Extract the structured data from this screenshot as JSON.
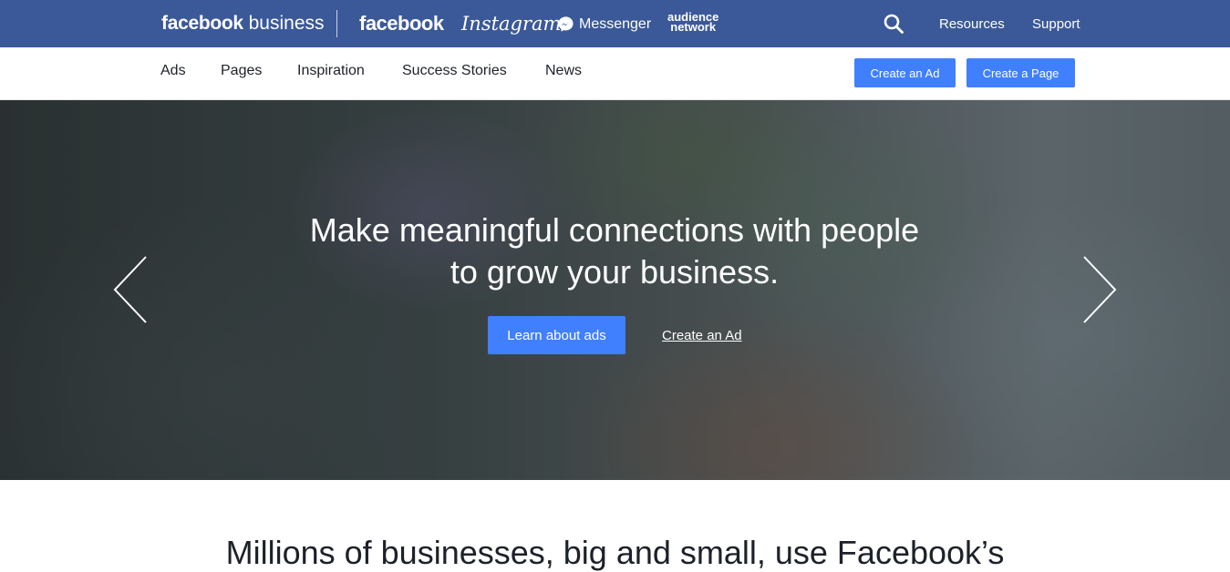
{
  "header": {
    "brand_bold": "facebook",
    "brand_light": " business",
    "platforms": {
      "facebook": "facebook",
      "instagram": "Instagram",
      "messenger": "Messenger",
      "audience_line1": "audience",
      "audience_line2": "network"
    },
    "search_icon": "search-icon",
    "links": {
      "resources": "Resources",
      "support": "Support"
    }
  },
  "subnav": {
    "items": [
      "Ads",
      "Pages",
      "Inspiration",
      "Success Stories",
      "News"
    ],
    "buttons": {
      "create_ad": "Create an Ad",
      "create_page": "Create a Page"
    }
  },
  "hero": {
    "headline_line1": "Make meaningful connections with people",
    "headline_line2": "to grow your business.",
    "primary_cta": "Learn about ads",
    "secondary_cta": "Create an Ad",
    "prev_icon": "chevron-left-icon",
    "next_icon": "chevron-right-icon"
  },
  "section": {
    "heading": "Millions of businesses, big and small, use Facebook’s"
  },
  "colors": {
    "header_bg": "#3b5998",
    "button_blue": "#4080ff",
    "text_dark": "#1d2129"
  }
}
